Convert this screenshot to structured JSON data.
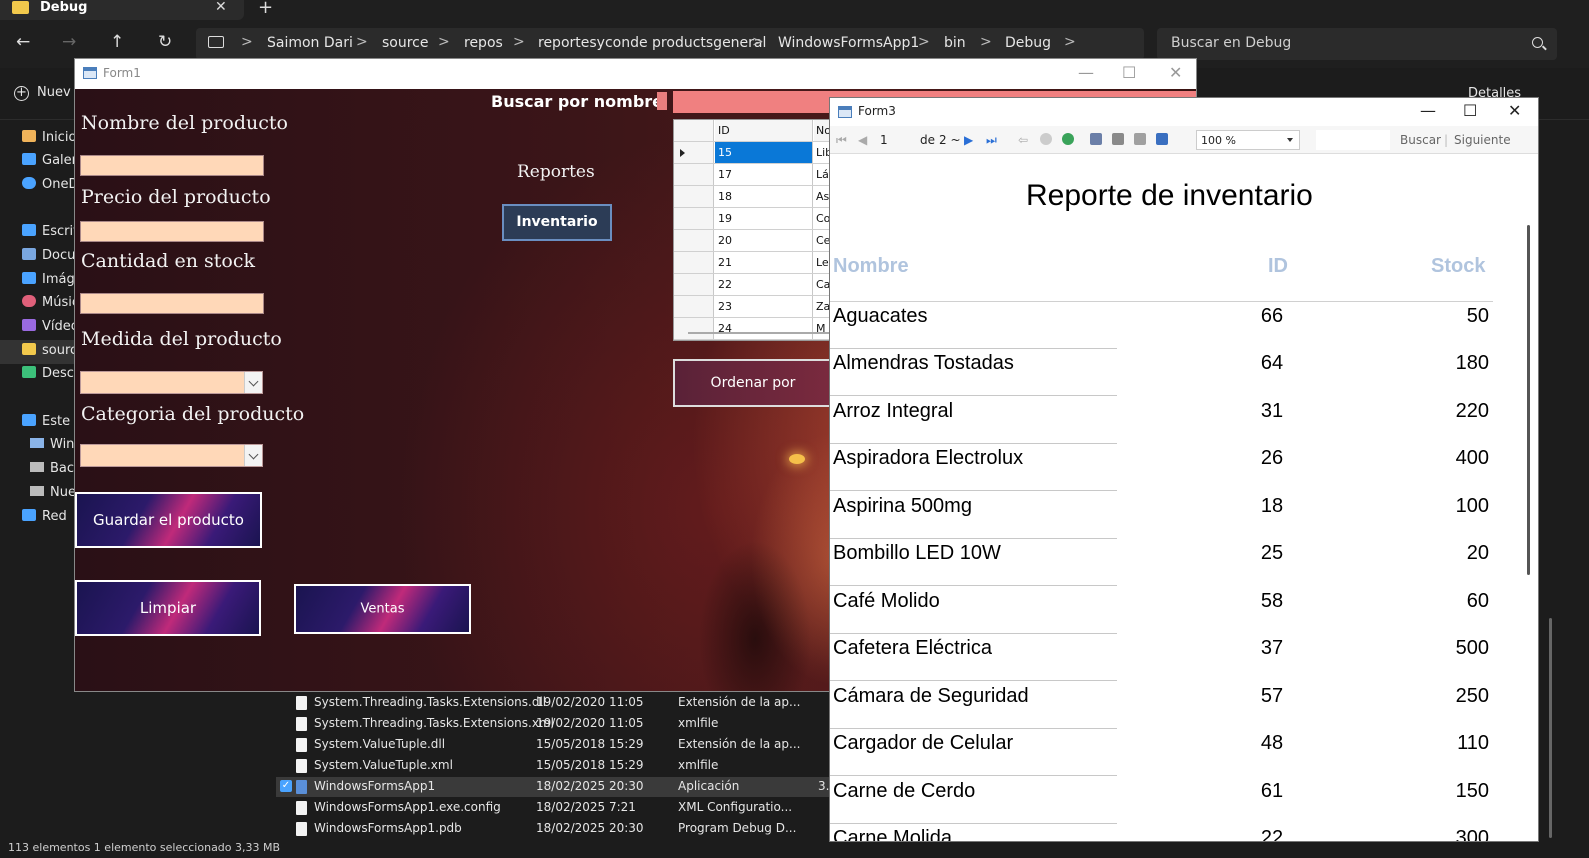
{
  "explorer": {
    "tab_title": "Debug",
    "tab_close": "✕",
    "new_tab": "+",
    "nav": {
      "back": "←",
      "forward": "→",
      "up": "↑",
      "refresh": "↻"
    },
    "breadcrumb": [
      "Saimon Dari",
      "source",
      "repos",
      "reportesyconde productsgeneral",
      "WindowsFormsApp1",
      "bin",
      "Debug"
    ],
    "breadcrumb_sep": ">",
    "search_placeholder": "Buscar en Debug",
    "cmd_new": "Nuev",
    "cmd_details": "Detalles",
    "sidebar": [
      {
        "label": "Inicio",
        "icon": "home-icon",
        "color": "#f0b35a"
      },
      {
        "label": "Galerí",
        "icon": "gallery-icon",
        "color": "#4aa3ff"
      },
      {
        "label": "OneD",
        "icon": "onedrive-icon",
        "color": "#4aa3ff"
      },
      {
        "label": "Escrito",
        "icon": "desktop-icon",
        "color": "#4aa3ff"
      },
      {
        "label": "Docur",
        "icon": "documents-icon",
        "color": "#7aa7e0"
      },
      {
        "label": "Imáge",
        "icon": "pictures-icon",
        "color": "#4aa3ff"
      },
      {
        "label": "Músic",
        "icon": "music-icon",
        "color": "#e0607a"
      },
      {
        "label": "Vídeo",
        "icon": "videos-icon",
        "color": "#9a6ae0"
      },
      {
        "label": "sourc",
        "icon": "folder-icon",
        "color": "#f2c94c"
      },
      {
        "label": "Desca",
        "icon": "downloads-icon",
        "color": "#3cc07a"
      },
      {
        "label": "Este e",
        "icon": "this-pc-icon",
        "color": "#4aa3ff"
      },
      {
        "label": "Wind",
        "icon": "drive-icon",
        "color": "#8ab4e8"
      },
      {
        "label": "Back",
        "icon": "drive-icon",
        "color": "#bbbbbb"
      },
      {
        "label": "Nue",
        "icon": "drive-icon",
        "color": "#bbbbbb"
      },
      {
        "label": "Red",
        "icon": "network-icon",
        "color": "#4aa3ff"
      }
    ],
    "files": [
      {
        "name": "System.Threading.Tasks.Extensions.dll",
        "date": "19/02/2020 11:05",
        "type": "Extensión de la ap...",
        "extra": ""
      },
      {
        "name": "System.Threading.Tasks.Extensions.xml",
        "date": "19/02/2020 11:05",
        "type": "xmlfile",
        "extra": ""
      },
      {
        "name": "System.ValueTuple.dll",
        "date": "15/05/2018 15:29",
        "type": "Extensión de la ap...",
        "extra": ""
      },
      {
        "name": "System.ValueTuple.xml",
        "date": "15/05/2018 15:29",
        "type": "xmlfile",
        "extra": ""
      },
      {
        "name": "WindowsFormsApp1",
        "date": "18/02/2025 20:30",
        "type": "Aplicación",
        "extra": "3."
      },
      {
        "name": "WindowsFormsApp1.exe.config",
        "date": "18/02/2025 7:21",
        "type": "XML Configuratio...",
        "extra": ""
      },
      {
        "name": "WindowsFormsApp1.pdb",
        "date": "18/02/2025 20:30",
        "type": "Program Debug D...",
        "extra": ""
      }
    ],
    "status": "113 elementos   1 elemento seleccionado  3,33 MB"
  },
  "form1": {
    "title": "Form1",
    "controls": {
      "minimize": "—",
      "maximize": "☐",
      "close": "✕"
    },
    "labels": {
      "nombre": "Nombre del producto",
      "precio": "Precio del producto",
      "cantidad": "Cantidad en stock",
      "medida": "Medida del producto",
      "categoria": "Categoria del producto",
      "buscar": "Buscar por nombre",
      "reportes": "Reportes"
    },
    "buttons": {
      "guardar": "Guardar el producto",
      "limpiar": "Limpiar",
      "ventas": "Ventas",
      "inventario": "Inventario",
      "ordenar": "Ordenar por"
    },
    "grid": {
      "headers": [
        "ID",
        "No"
      ],
      "rows": [
        {
          "id": "15",
          "name": "Lib"
        },
        {
          "id": "17",
          "name": "Lár"
        },
        {
          "id": "18",
          "name": "Asp"
        },
        {
          "id": "19",
          "name": "Co"
        },
        {
          "id": "20",
          "name": "Cer"
        },
        {
          "id": "21",
          "name": "Lec"
        },
        {
          "id": "22",
          "name": "Ca"
        },
        {
          "id": "23",
          "name": "Zar"
        },
        {
          "id": "24",
          "name": "M"
        }
      ]
    }
  },
  "form3": {
    "title": "Form3",
    "controls": {
      "minimize": "—",
      "maximize": "☐",
      "close": "✕"
    },
    "toolbar": {
      "page": "1",
      "of_label": "de",
      "total_pages": "2 ~",
      "zoom": "100 %",
      "find": "Buscar",
      "next": "Siguiente"
    },
    "report": {
      "title": "Reporte de inventario",
      "headers": {
        "nombre": "Nombre",
        "id": "ID",
        "stock": "Stock"
      },
      "header_color": "#b0c4de",
      "rows": [
        {
          "nombre": "Aguacates",
          "id": "66",
          "stock": "50"
        },
        {
          "nombre": "Almendras Tostadas",
          "id": "64",
          "stock": "180"
        },
        {
          "nombre": "Arroz Integral",
          "id": "31",
          "stock": "220"
        },
        {
          "nombre": "Aspiradora Electrolux",
          "id": "26",
          "stock": "400"
        },
        {
          "nombre": "Aspirina 500mg",
          "id": "18",
          "stock": "100"
        },
        {
          "nombre": "Bombillo LED 10W",
          "id": "25",
          "stock": "20"
        },
        {
          "nombre": "Café Molido",
          "id": "58",
          "stock": "60"
        },
        {
          "nombre": "Cafetera Eléctrica",
          "id": "37",
          "stock": "500"
        },
        {
          "nombre": "Cámara de Seguridad",
          "id": "57",
          "stock": "250"
        },
        {
          "nombre": "Cargador de Celular",
          "id": "48",
          "stock": "110"
        },
        {
          "nombre": "Carne de Cerdo",
          "id": "61",
          "stock": "150"
        },
        {
          "nombre": "Carne Molida",
          "id": "22",
          "stock": "300"
        }
      ]
    }
  }
}
